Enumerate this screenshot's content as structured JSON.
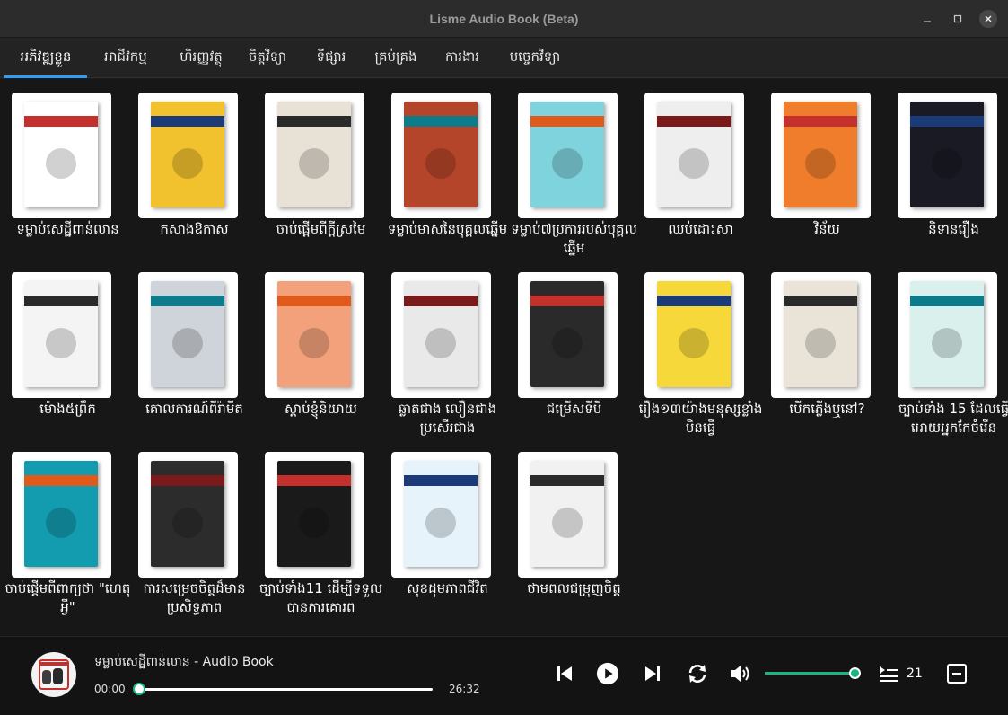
{
  "window": {
    "title": "Lisme Audio Book (Beta)"
  },
  "tabs": [
    {
      "label": "អភិវឌ្ឍខ្លួន"
    },
    {
      "label": "អាជីវកម្ម"
    },
    {
      "label": "ហិរញ្ញវត្ថុ"
    },
    {
      "label": "ចិត្តវិទ្យា"
    },
    {
      "label": "ទីផ្សារ"
    },
    {
      "label": "គ្រប់គ្រង"
    },
    {
      "label": "ការងារ"
    },
    {
      "label": "បច្ចេកវិទ្យា"
    }
  ],
  "books": [
    {
      "title": "ទម្លាប់សេដ្ឋីពាន់លាន"
    },
    {
      "title": "កសាងឱកាស"
    },
    {
      "title": "ចាប់ផ្តើមពីក្តីស្រមៃ"
    },
    {
      "title": "ទម្លាប់មាសនៃបុគ្គលឆ្នើម"
    },
    {
      "title": "ទម្លាប់៧ប្រការរបស់បុគ្គលឆ្នើម"
    },
    {
      "title": "ឈប់ដោះសា"
    },
    {
      "title": "វិន័យ"
    },
    {
      "title": "និទានរឿង"
    },
    {
      "title": "ម៉ោង៥ព្រឹក"
    },
    {
      "title": "គោលការណ៍ពីរ៉ាមីត"
    },
    {
      "title": "ស្តាប់ខ្ញុំនិយាយ"
    },
    {
      "title": "ឆ្លាតជាង លឿនជាង ប្រសើរជាង"
    },
    {
      "title": "ជម្រើសទីបី"
    },
    {
      "title": "រឿង១៣យ៉ាងមនុស្សខ្លាំងមិនធ្វើ"
    },
    {
      "title": "បើកភ្លើងឬនៅ?"
    },
    {
      "title": "ច្បាប់ទាំង 15 ដែលធ្វើអោយអ្នកកែចំរើន"
    },
    {
      "title": "ចាប់ផ្តើមពីពាក្យថា \"ហេតុអ្វី\""
    },
    {
      "title": "ការសម្រេចចិត្តដ៏មានប្រសិទ្ធភាព"
    },
    {
      "title": "ច្បាប់ទាំង11 ដើម្បីទទួលបានការគោរព"
    },
    {
      "title": "សុខដុមភាពជីវិត"
    },
    {
      "title": "ថាមពលជម្រុញចិត្ត"
    }
  ],
  "cover_colors": [
    "#ffffff",
    "#f2c12e",
    "#e8e1d6",
    "#b5452a",
    "#7fd3dd",
    "#eeeeee",
    "#f07d2b",
    "#1a1a24",
    "#f4f4f4",
    "#cfd4da",
    "#f3a17b",
    "#e9e9e9",
    "#2a2a2a",
    "#f7d83a",
    "#e9e4d7",
    "#d9f0ec",
    "#139bb0",
    "#2c2c2c",
    "#1a1a1a",
    "#e6f3fb",
    "#f1f1f1"
  ],
  "player": {
    "track_title": "ទម្លាប់សេដ្ឋីពាន់លាន - Audio Book",
    "current_time": "00:00",
    "total_time": "26:32",
    "progress": 0.0,
    "volume": 1.0,
    "playlist_count": "21"
  },
  "colors": {
    "accent": "#2e9ff7",
    "player_accent": "#1db37f"
  }
}
